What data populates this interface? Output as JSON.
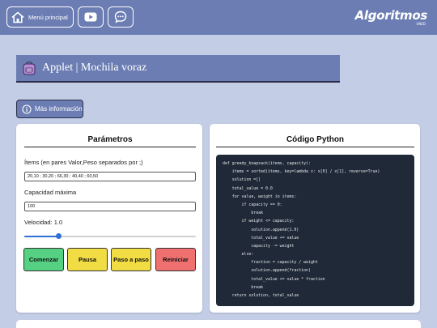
{
  "nav": {
    "menu_label": "Menú principal",
    "logo_text": "Algoritmos",
    "logo_subtext": "UNED",
    "color": "#6b7db3"
  },
  "header": {
    "title": "Applet | Mochila voraz"
  },
  "info_button": {
    "label": "Más información"
  },
  "params": {
    "title": "Parámetros",
    "items_label": "Ítems (en pares Valor,Peso separados por ;)",
    "items_value": "20,10 ; 30,20 ; 66,30 ; 40,40 ; 60,50",
    "capacity_label": "Capacidad máxima",
    "capacity_value": "100",
    "speed_label": "Velocidad: 1.0",
    "speed_fraction": 0.2,
    "buttons": {
      "start": "Comenzar",
      "pause": "Pausa",
      "step": "Paso a paso",
      "reset": "Reiniciar"
    }
  },
  "code": {
    "title": "Código Python",
    "lines": [
      "def greedy_knapsack(items, capacity):",
      "    items = sorted(items, key=lambda x: x[0] / x[1], reverse=True)",
      "    solution =[]",
      "    total_value = 0.0",
      "    for value, weight in items:",
      "        if capacity == 0:",
      "            break",
      "        if weight <= capacity:",
      "            solution.append(1.0)",
      "            total_value += value",
      "            capacity -= weight",
      "        else:",
      "            fraction = capacity / weight",
      "            solution.append(fraction)",
      "            total_value += value * fraction",
      "            break",
      "    return solution, total_value"
    ]
  }
}
